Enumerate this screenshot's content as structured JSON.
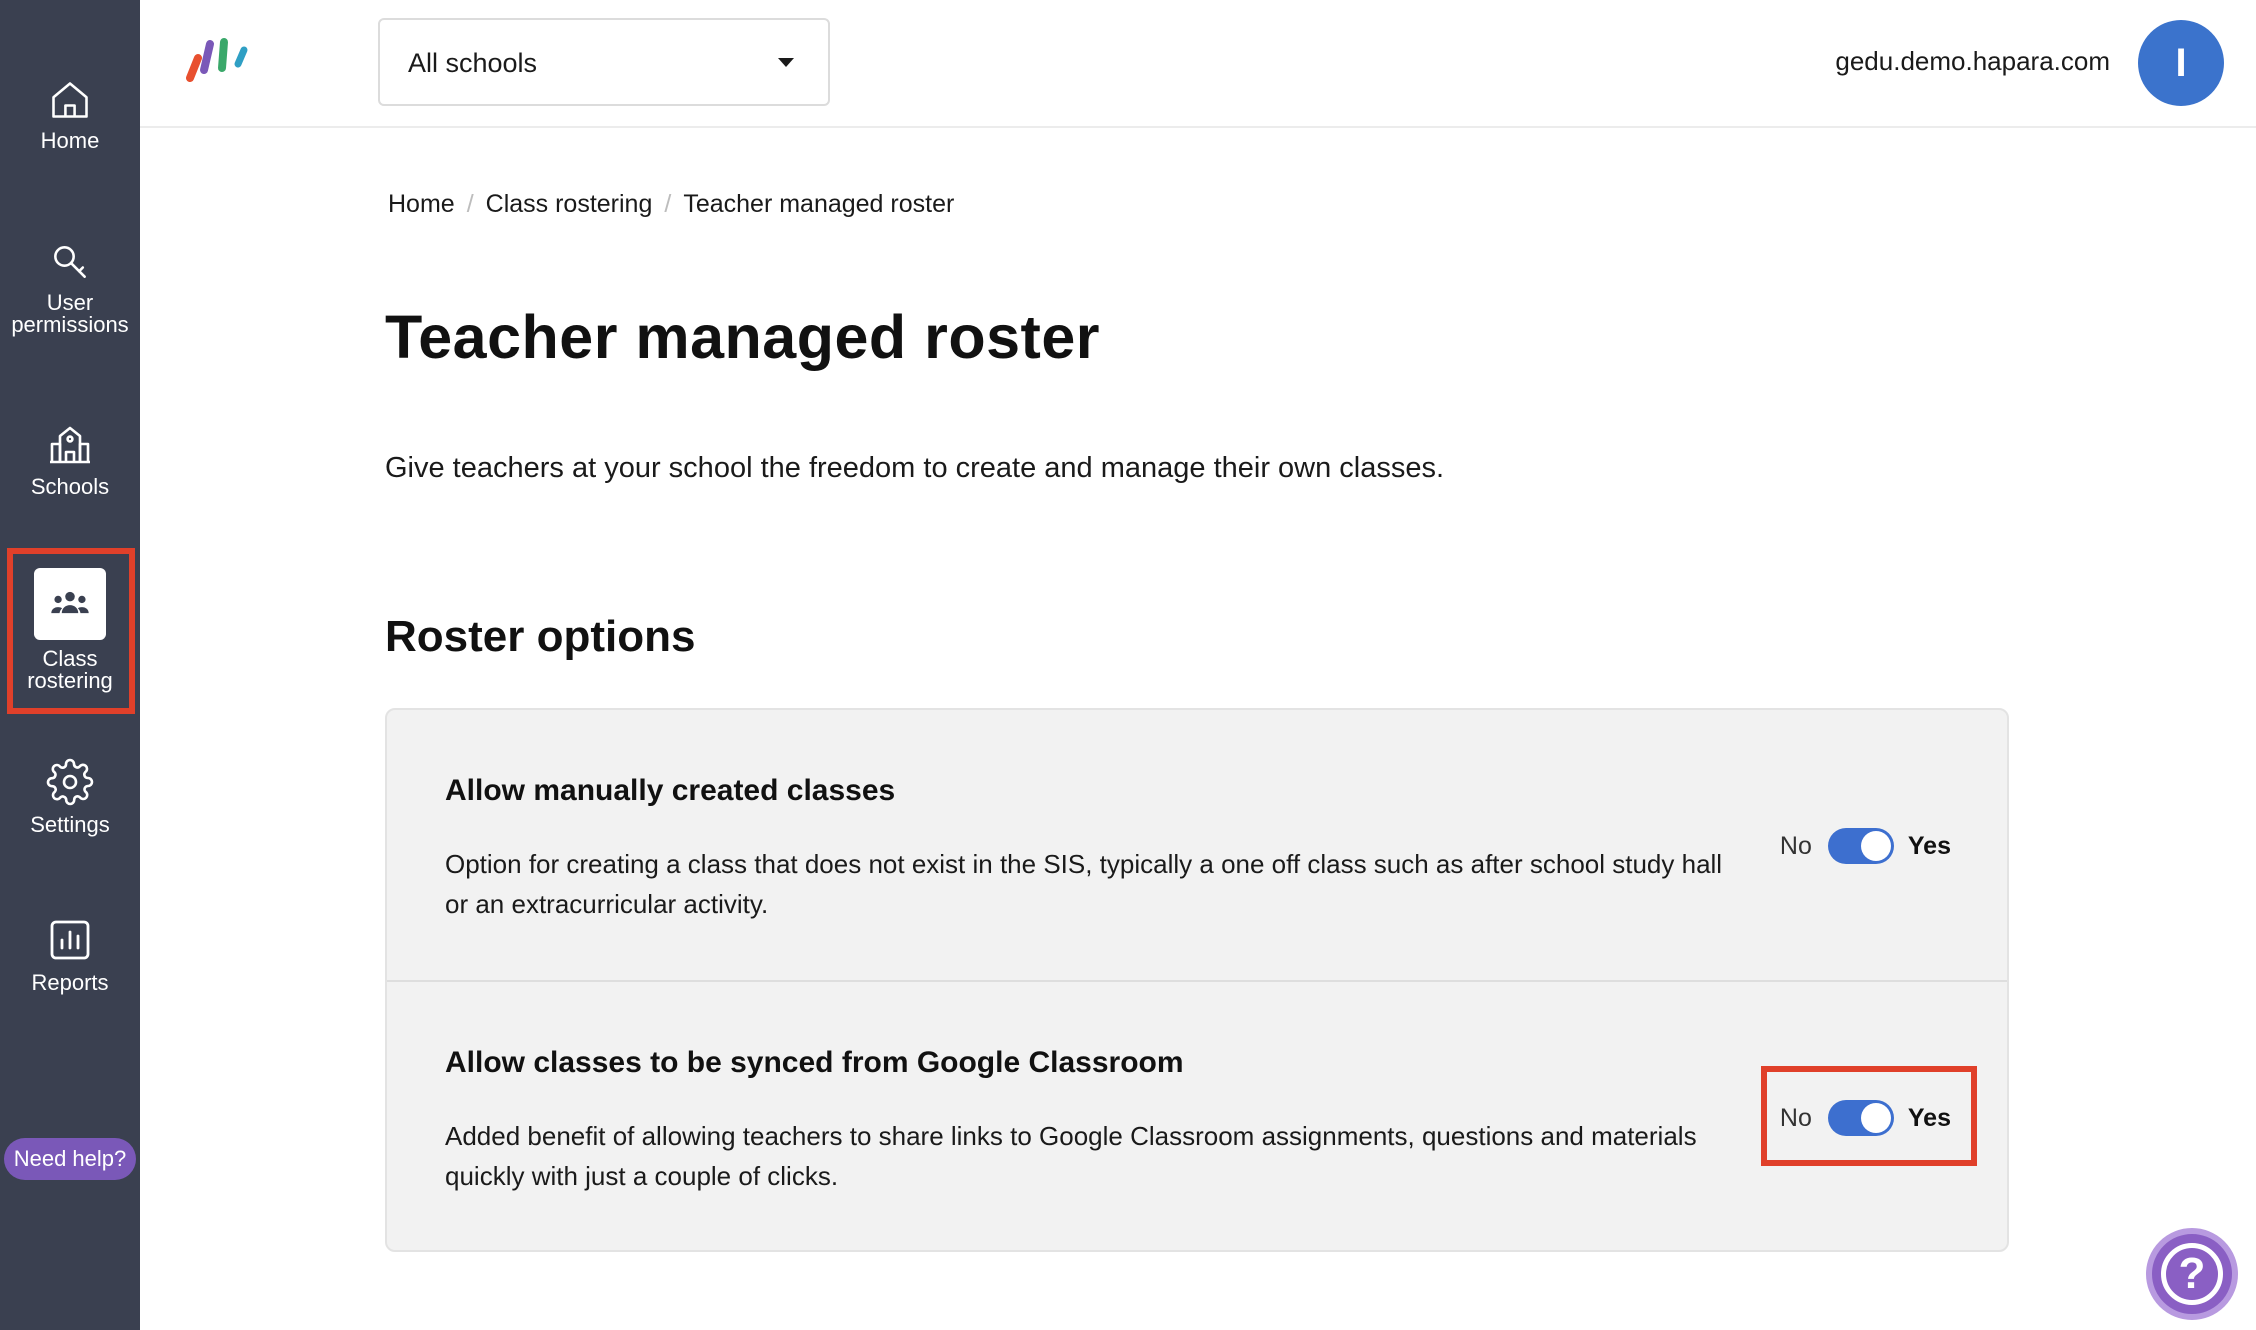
{
  "sidebar": {
    "items": [
      {
        "label": "Home",
        "icon": "home-icon"
      },
      {
        "label_line1": "User",
        "label_line2": "permissions",
        "icon": "key-icon"
      },
      {
        "label": "Schools",
        "icon": "school-icon"
      },
      {
        "label_line1": "Class",
        "label_line2": "rostering",
        "icon": "people-icon",
        "active": true
      },
      {
        "label": "Settings",
        "icon": "gear-icon"
      },
      {
        "label": "Reports",
        "icon": "chart-icon"
      }
    ],
    "help_label": "Need help?"
  },
  "header": {
    "school_select": {
      "value": "All schools"
    },
    "domain": "gedu.demo.hapara.com",
    "avatar_initial": "I"
  },
  "breadcrumb": [
    "Home",
    "Class rostering",
    "Teacher managed roster"
  ],
  "page": {
    "title": "Teacher managed roster",
    "description": "Give teachers at your school the freedom to create and manage their own classes.",
    "section_title": "Roster options"
  },
  "options": [
    {
      "title": "Allow manually created classes",
      "description": "Option for creating a class that does not exist in the SIS, typically a one off class such as after school study hall or an extracurricular activity.",
      "no_label": "No",
      "yes_label": "Yes",
      "enabled": true
    },
    {
      "title": "Allow classes to be synced from Google Classroom",
      "description": "Added benefit of allowing teachers to share links to Google Classroom assignments, questions and materials quickly with just a couple of clicks.",
      "no_label": "No",
      "yes_label": "Yes",
      "enabled": true
    }
  ],
  "colors": {
    "sidebar_bg": "#3a4050",
    "accent": "#3d6fcf",
    "highlight": "#e0402a",
    "help": "#8a5fc4"
  }
}
